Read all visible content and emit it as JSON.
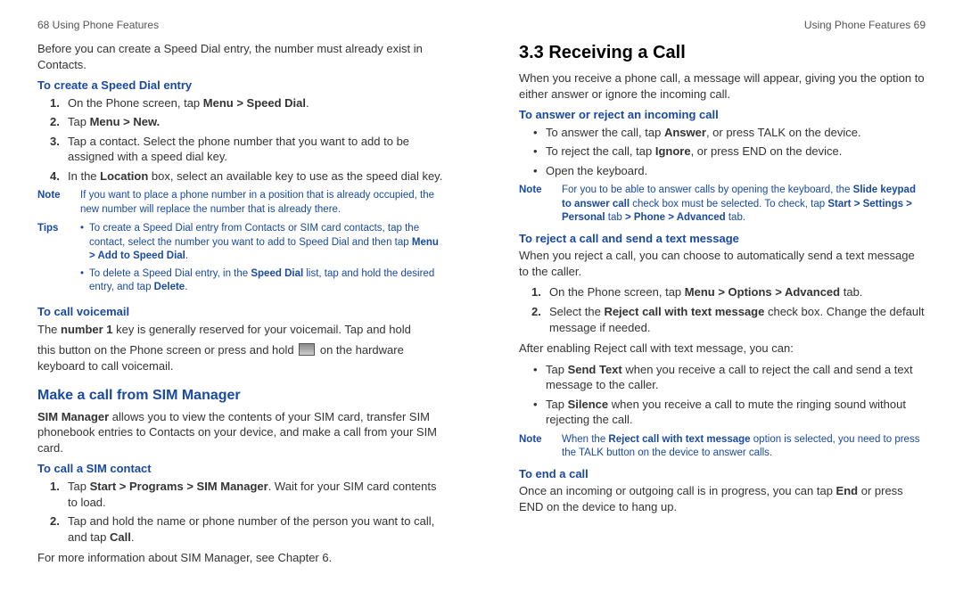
{
  "left": {
    "runhead": "68  Using Phone Features",
    "intro": "Before you can create a Speed Dial entry, the number must already exist in Contacts.",
    "h_create": "To create a Speed Dial entry",
    "s1_a": "On the Phone screen, tap ",
    "s1_b": "Menu > Speed Dial",
    "s1_c": ".",
    "s2_a": "Tap ",
    "s2_b": "Menu > New.",
    "s3": "Tap a contact. Select the phone number that you want to add to be assigned with a speed dial key.",
    "s4_a": "In the ",
    "s4_b": "Location",
    "s4_c": " box, select an available key to use as the speed dial key.",
    "note_label": "Note",
    "note_text": "If you want to place a phone number in a position that is already occupied, the new number will replace the number that is already there.",
    "tips_label": "Tips",
    "tip1_a": "To create a Speed Dial entry from Contacts or SIM card contacts, tap the contact, select the number you want to add to Speed Dial and then tap ",
    "tip1_b": "Menu > Add to Speed Dial",
    "tip1_c": ".",
    "tip2_a": "To delete a Speed Dial entry, in the ",
    "tip2_b": "Speed Dial",
    "tip2_c": " list, tap and hold the desired entry, and tap ",
    "tip2_d": "Delete",
    "tip2_e": ".",
    "h_vm": "To call voicemail",
    "vm_a": "The ",
    "vm_b": "number 1",
    "vm_c": " key is generally reserved for your voicemail. Tap and hold",
    "vm_d": "this button on the Phone screen or press and hold ",
    "vm_e": " on the hardware keyboard to call voicemail.",
    "h_sim": "Make a call from SIM Manager",
    "sim_a": "SIM Manager",
    "sim_b": " allows you to view the contents of your SIM card, transfer SIM phonebook entries to Contacts on your device, and make a call from your SIM card.",
    "h_simcall": "To call a SIM contact",
    "ss1_a": "Tap ",
    "ss1_b": "Start > Programs > SIM Manager",
    "ss1_c": ". Wait for your SIM card contents to load.",
    "ss2_a": "Tap and hold the name or phone number of the person you want to call, and tap ",
    "ss2_b": "Call",
    "ss2_c": ".",
    "sim_more": "For more information about SIM Manager, see Chapter 6."
  },
  "right": {
    "runhead": "Using Phone Features  69",
    "h1": "3.3  Receiving a Call",
    "intro": "When you receive a phone call, a message will appear, giving you the option to either answer or ignore the incoming call.",
    "h_ans": "To answer or reject an incoming call",
    "a1_a": "To answer the call, tap ",
    "a1_b": "Answer",
    "a1_c": ", or press TALK on the device.",
    "a2_a": "To reject the call, tap ",
    "a2_b": "Ignore",
    "a2_c": ", or press END on the device.",
    "a3": "Open the keyboard.",
    "note_label": "Note",
    "note_a": "For you to be able to answer calls by opening the keyboard, the ",
    "note_b": "Slide keypad to answer call",
    "note_c": " check box must be selected. To check, tap ",
    "note_d": "Start > Settings > Personal ",
    "note_e": "tab ",
    "note_f": "> Phone > Advanced",
    "note_g": " tab.",
    "h_rej": "To reject a call and send a text message",
    "rej_intro": "When you reject a call, you can choose to automatically send a text message to the caller.",
    "r1_a": "On the Phone screen, tap ",
    "r1_b": "Menu > Options > Advanced",
    "r1_c": " tab.",
    "r2_a": "Select the ",
    "r2_b": "Reject call with text message",
    "r2_c": " check box. Change the default message if needed.",
    "after": "After enabling Reject call with text message, you can:",
    "b1_a": "Tap ",
    "b1_b": "Send Text",
    "b1_c": " when you receive a call to reject the call and send a text message to the caller.",
    "b2_a": "Tap ",
    "b2_b": "Silence",
    "b2_c": " when you receive a call to mute the ringing sound without rejecting the call.",
    "note2_label": "Note",
    "note2_a": "When the ",
    "note2_b": "Reject call with text message",
    "note2_c": " option is selected, you need to press the TALK button on the device to answer calls.",
    "h_end": "To end a call",
    "end_a": "Once an incoming or outgoing call is in progress, you can tap ",
    "end_b": "End",
    "end_c": " or press END on the device to hang up."
  }
}
